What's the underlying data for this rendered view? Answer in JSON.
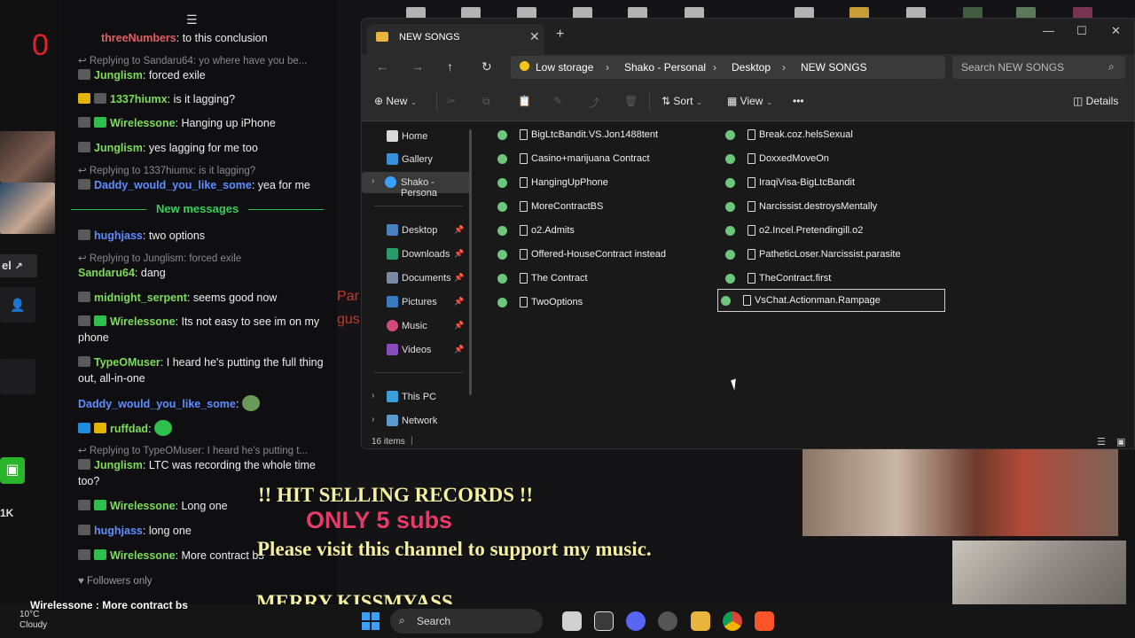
{
  "overlay": {
    "counter": "0",
    "strip_label": "el",
    "strip_count": "1K",
    "line1": "!! HIT SELLING RECORDS !!",
    "line2": "ONLY 5 subs",
    "line3": "Please visit this channel to support my music.",
    "line4": "MERRY KISSMYASS",
    "ticker": "Wirelessone : More contract bs",
    "partial_left": "Par\ngus"
  },
  "chat": {
    "messages": [
      {
        "user": "threeNumbers",
        "text": "to this conclusion",
        "color": "#e06060"
      },
      {
        "reply": "Replying to Sandaru64: yo where have you be..."
      },
      {
        "user": "Junglism",
        "text": "forced exile",
        "color": "#7ddc5a"
      },
      {
        "user": "1337hiumx",
        "text": "is it lagging?",
        "color": "#7ddc5a"
      },
      {
        "user": "Wirelessone",
        "text": "Hanging up iPhone",
        "color": "#7ddc5a"
      },
      {
        "user": "Junglism",
        "text": "yes lagging for me too",
        "color": "#7ddc5a"
      },
      {
        "reply": "Replying to 1337hiumx: is it lagging?"
      },
      {
        "user": "Daddy_would_you_like_some",
        "text": "yea for me",
        "color": "#5f8dff"
      },
      {
        "user": "hughjass",
        "text": "two options",
        "color": "#5f8dff"
      },
      {
        "reply": "Replying to Junglism: forced exile"
      },
      {
        "user": "Sandaru64",
        "text": "dang",
        "color": "#7ddc5a"
      },
      {
        "user": "midnight_serpent",
        "text": "seems good now",
        "color": "#7ddc5a"
      },
      {
        "user": "Wirelessone",
        "text": "Its not easy to see im on my phone",
        "color": "#7ddc5a"
      },
      {
        "user": "TypeOMuser",
        "text": "I heard he's putting the full thing out, all-in-one",
        "color": "#7ddc5a"
      },
      {
        "user": "Daddy_would_you_like_some",
        "text": "",
        "color": "#5f8dff"
      },
      {
        "user": "ruffdad",
        "text": "",
        "color": "#7ddc5a"
      },
      {
        "reply": "Replying to TypeOMuser: I heard he's putting t..."
      },
      {
        "user": "Junglism",
        "text": "LTC was recording the whole time too?",
        "color": "#7ddc5a"
      },
      {
        "user": "Wirelessone",
        "text": "Long one",
        "color": "#7ddc5a"
      },
      {
        "user": "hughjass",
        "text": "long one",
        "color": "#5f8dff"
      },
      {
        "user": "Wirelessone",
        "text": "More contract bs",
        "color": "#7ddc5a"
      }
    ],
    "new_messages": "New messages",
    "followers": "Followers only"
  },
  "explorer": {
    "tab_title": "NEW SONGS",
    "address": {
      "warning": "Low storage",
      "crumbs": [
        "Shako - Personal",
        "Desktop",
        "NEW SONGS"
      ]
    },
    "search_placeholder": "Search NEW SONGS",
    "toolbar": {
      "new": "New",
      "sort": "Sort",
      "view": "View",
      "more": "•••",
      "details": "Details"
    },
    "nav": {
      "home": "Home",
      "gallery": "Gallery",
      "shako": "Shako - Persona",
      "desktop": "Desktop",
      "downloads": "Downloads",
      "documents": "Documents",
      "pictures": "Pictures",
      "music": "Music",
      "videos": "Videos",
      "thispc": "This PC",
      "network": "Network"
    },
    "files_col1": [
      "BigLtcBandit.VS.Jon1488tent",
      "Casino+marijuana Contract",
      "HangingUpPhone",
      "MoreContractBS",
      "o2.Admits",
      "Offered-HouseContract instead",
      "The Contract",
      "TwoOptions"
    ],
    "files_col2": [
      "Break.coz.helsSexual",
      "DoxxedMoveOn",
      "IraqiVisa-BigLtcBandit",
      "Narcissist.destroysMentally",
      "o2.Incel.Pretendingill.o2",
      "PatheticLoser.Narcissist.parasite",
      "TheContract.first",
      "VsChat.Actionman.Rampage"
    ],
    "status": "16 items"
  },
  "taskbar": {
    "temp": "10°C",
    "weather": "Cloudy",
    "search": "Search"
  },
  "colors": {
    "accent": "#3aa0ff",
    "sub": "#2fbf4c",
    "warn": "#f5c518",
    "overlay_yellow": "#f4f0a0",
    "overlay_pink": "#e83a6a"
  }
}
